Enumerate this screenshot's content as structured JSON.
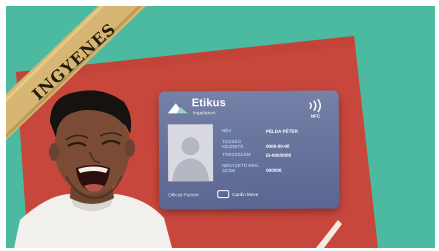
{
  "badge": {
    "text": "INGYENES"
  },
  "card": {
    "brand_name": "Etikus",
    "brand_sub": "Ingatlanos",
    "nfc_label": "NFC",
    "fields": [
      {
        "label": "NÉV",
        "value": "PÉLDA PÉTER"
      },
      {
        "label": "TAGSÁG KEZDETE",
        "value": "0000-00-00"
      },
      {
        "label": "TÖRZSSZÁM",
        "value": "EI-000/0000"
      },
      {
        "label": "NÉGYZETÜ REG. SZÁM",
        "value": "000000"
      }
    ],
    "partner_label": "Official Partner:",
    "partner_name": "Cardin Move"
  },
  "colors": {
    "teal_background": "#4cbaa0",
    "red_panel": "#c8473c",
    "card": "#6a749e",
    "ribbon": "#d6b672"
  }
}
